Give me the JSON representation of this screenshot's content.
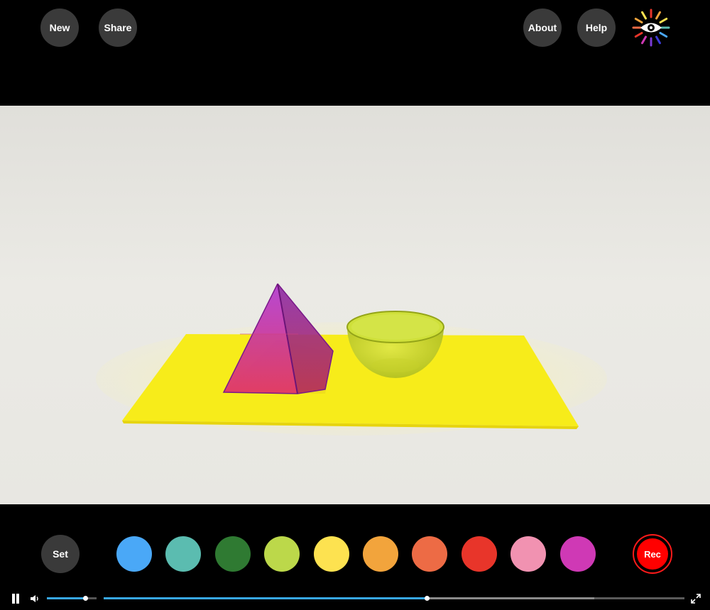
{
  "header": {
    "new_label": "New",
    "share_label": "Share",
    "about_label": "About",
    "help_label": "Help",
    "logo_icon": "eye-sunburst-icon"
  },
  "palette": {
    "set_label": "Set",
    "swatches": [
      {
        "name": "blue",
        "color": "#4aa8f7"
      },
      {
        "name": "teal",
        "color": "#5bbcb0"
      },
      {
        "name": "green",
        "color": "#2f7a32"
      },
      {
        "name": "lime",
        "color": "#bcd84a"
      },
      {
        "name": "yellow",
        "color": "#fde250"
      },
      {
        "name": "orange",
        "color": "#f2a43c"
      },
      {
        "name": "coral",
        "color": "#ed6b45"
      },
      {
        "name": "red",
        "color": "#e8352a"
      },
      {
        "name": "pink",
        "color": "#f192b1"
      },
      {
        "name": "magenta",
        "color": "#cf39b5"
      }
    ],
    "rec_label": "Rec"
  },
  "player": {
    "play_state_icon": "pause-icon",
    "volume_level": 0.78,
    "progress": 0.557,
    "buffered": 0.845
  },
  "colors": {
    "accent_blue": "#38a8e8",
    "rec_red": "#ff0000",
    "button_gray": "#3a3a3a"
  }
}
